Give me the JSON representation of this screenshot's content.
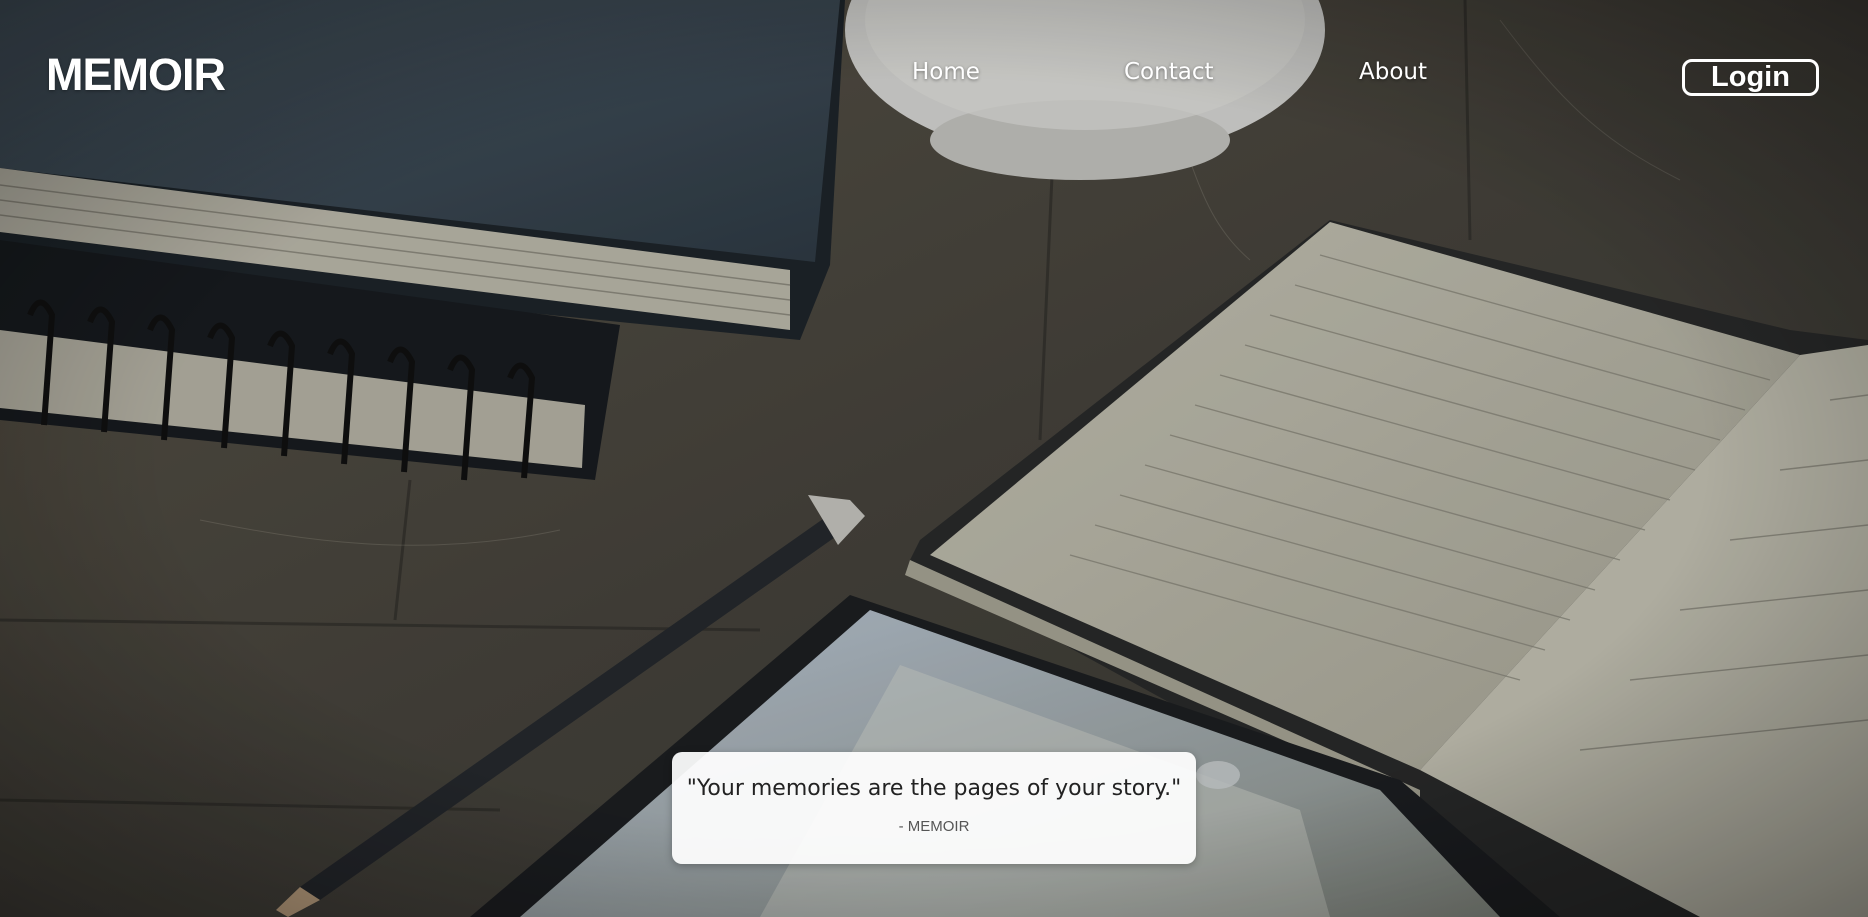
{
  "header": {
    "logo": "MEMOIR",
    "nav": [
      {
        "label": "Home"
      },
      {
        "label": "Contact"
      },
      {
        "label": "About"
      }
    ],
    "login_label": "Login"
  },
  "hero": {
    "background_subject": "desk-with-notebooks-pencil-tablet-photo",
    "quote": "\"Your memories are the pages of your story.\"",
    "attribution": "- MEMOIR"
  },
  "colors": {
    "nav_text": "#ffffff",
    "quote_card_bg": "#f4f4f4",
    "quote_text": "#222222",
    "attribution_text": "#555555"
  }
}
